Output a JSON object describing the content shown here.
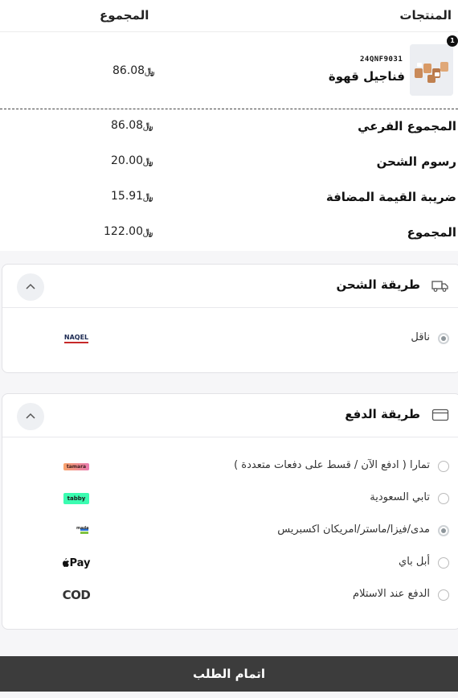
{
  "table": {
    "col_products": "المنتجات",
    "col_total": "المجموع"
  },
  "product": {
    "qty": "1",
    "sku": "24QNF9031",
    "name": "فناجيل قهوة",
    "price": "86.08"
  },
  "currency_symbol": "﷼",
  "summary": [
    {
      "label": "المجموع الفرعي",
      "value": "86.08"
    },
    {
      "label": "رسوم الشحن",
      "value": "20.00"
    },
    {
      "label": "ضريبة القيمة المضافة",
      "value": "15.91"
    },
    {
      "label": "المجموع",
      "value": "122.00"
    }
  ],
  "shipping": {
    "title": "طريقة الشحن",
    "icon": "truck-icon",
    "options": [
      {
        "label": "ناقل",
        "logo": "NAQEL",
        "selected": true
      }
    ]
  },
  "payment": {
    "title": "طريقة الدفع",
    "icon": "card-icon",
    "options": [
      {
        "label": "تمارا ( ادفع الآن / قسط على دفعات متعددة )",
        "logo": "tamara",
        "selected": false
      },
      {
        "label": "تابي السعودية",
        "logo": "tabby",
        "selected": false
      },
      {
        "label": "مدى/فيزا/ماستر/امريكان اكسبريس",
        "logo": "mada",
        "selected": true
      },
      {
        "label": "أبل باي",
        "logo": "Pay",
        "selected": false
      },
      {
        "label": "الدفع عند الاستلام",
        "logo": "COD",
        "selected": false
      }
    ]
  },
  "submit_label": "اتمام الطلب",
  "colors": {
    "button_bg": "#3c3c3c",
    "page_bg": "#f6f6f8"
  }
}
